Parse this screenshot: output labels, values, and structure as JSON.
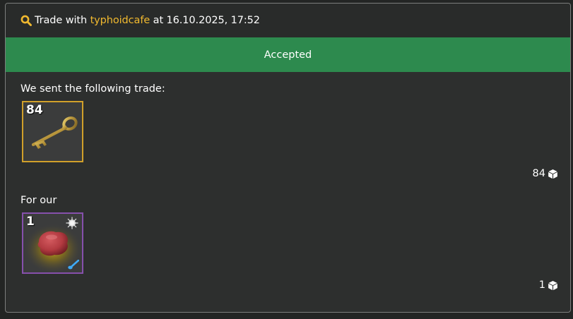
{
  "header": {
    "prefix": "Trade with",
    "partner_name": "typhoidcafe",
    "suffix": "at 16.10.2025, 17:52",
    "icon": "search-icon",
    "accent_color": "#f1b92f"
  },
  "status": {
    "label": "Accepted",
    "color": "#2d8a4e"
  },
  "sent": {
    "heading": "We sent the following trade:",
    "items": [
      {
        "quantity": "84",
        "icon": "key-icon",
        "border_color": "#d1a02a"
      }
    ],
    "total": "84",
    "total_icon": "cube-icon"
  },
  "received": {
    "heading": "For our",
    "items": [
      {
        "quantity": "1",
        "icon": "paint-blob-icon",
        "border_color": "#8650ac",
        "effect_icon": "sparkle-icon",
        "tool_icon": "paintbrush-icon"
      }
    ],
    "total": "1",
    "total_icon": "cube-icon"
  }
}
